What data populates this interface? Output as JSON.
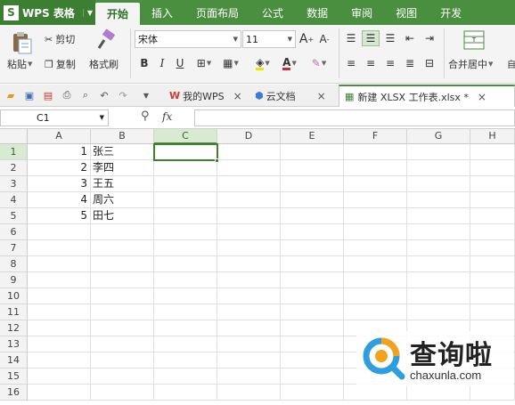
{
  "app": {
    "title": "WPS 表格",
    "logo_letter": "S"
  },
  "menu": {
    "tabs": [
      "开始",
      "插入",
      "页面布局",
      "公式",
      "数据",
      "审阅",
      "视图",
      "开发"
    ]
  },
  "ribbon": {
    "paste_label": "粘贴",
    "cut_label": "剪切",
    "copy_label": "复制",
    "format_painter_label": "格式刷",
    "font_name": "宋体",
    "font_size": "11",
    "grow_font_label": "A",
    "shrink_font_label": "A",
    "bold_label": "B",
    "italic_label": "I",
    "underline_label": "U",
    "font_color_label": "A",
    "merge_center_label": "合并居中",
    "colors": {
      "accent": "#4a8e3f",
      "font_color": "#d22b2b",
      "highlight": "#f2e100"
    }
  },
  "quickbar": {
    "tabs": [
      {
        "label": "我的WPS"
      },
      {
        "label": "云文档"
      },
      {
        "label": "新建 XLSX 工作表.xlsx *"
      }
    ]
  },
  "formula_bar": {
    "name_box": "C1",
    "fx_label": "fx",
    "formula": ""
  },
  "grid": {
    "columns": [
      "A",
      "B",
      "C",
      "D",
      "E",
      "F",
      "G",
      "H"
    ],
    "rows": [
      "1",
      "2",
      "3",
      "4",
      "5",
      "6",
      "7",
      "8",
      "9",
      "10",
      "11",
      "12",
      "13",
      "14",
      "15",
      "16"
    ],
    "selected_cell": "C1",
    "data": [
      {
        "a": "1",
        "b": "张三"
      },
      {
        "a": "2",
        "b": "李四"
      },
      {
        "a": "3",
        "b": "王五"
      },
      {
        "a": "4",
        "b": "周六"
      },
      {
        "a": "5",
        "b": "田七"
      }
    ]
  },
  "watermark": {
    "title": "查询啦",
    "site": "chaxunla.com"
  }
}
